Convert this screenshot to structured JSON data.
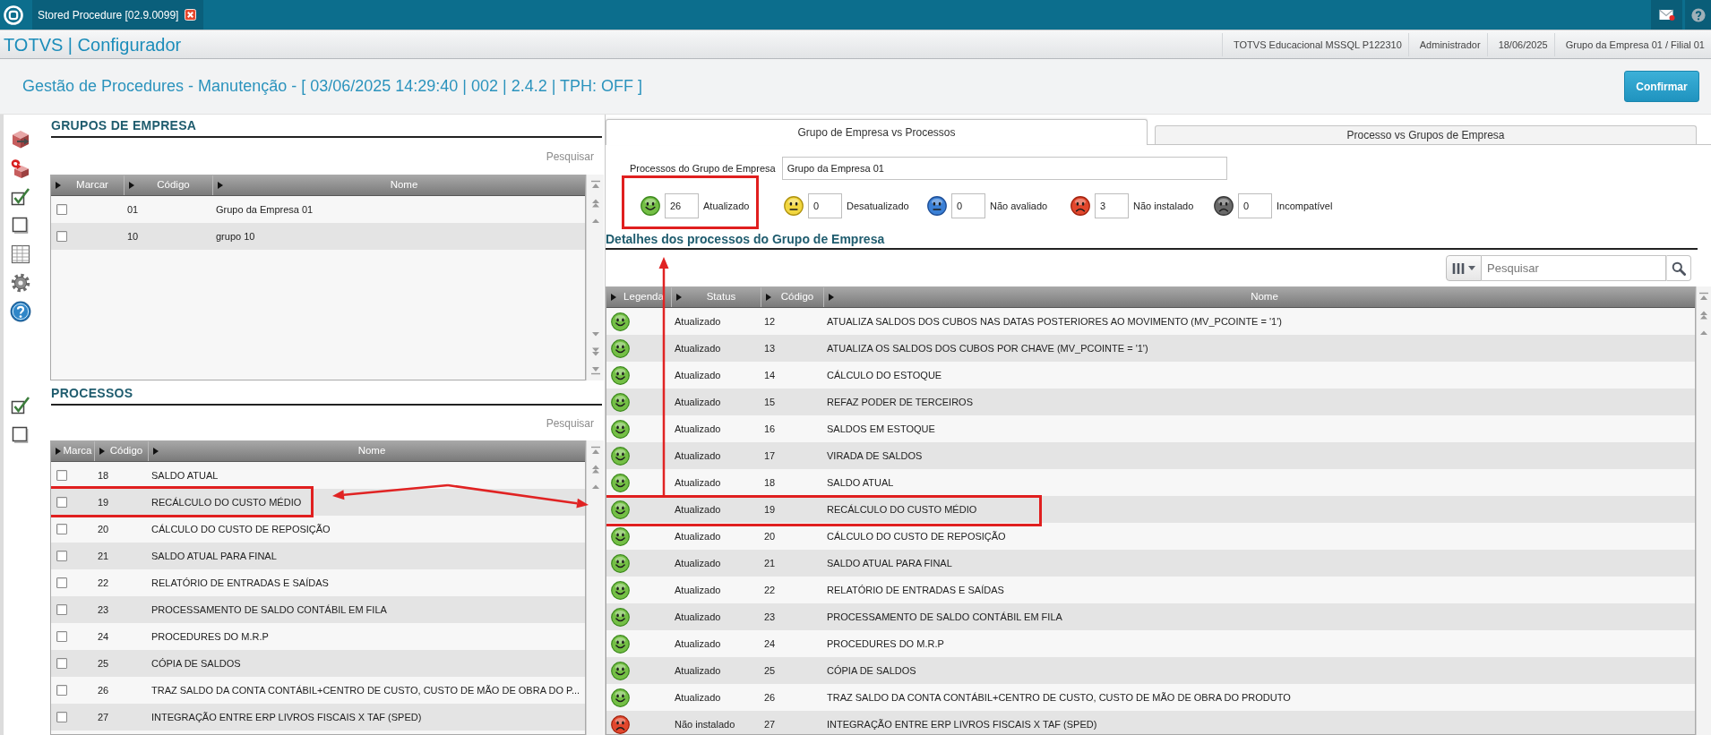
{
  "app_bar": {
    "tab_title": "Stored Procedure [02.9.0099]"
  },
  "header_bar": {
    "product": "TOTVS | Configurador",
    "info": [
      "TOTVS Educacional MSSQL P122310",
      "Administrador",
      "18/06/2025",
      "Grupo da Empresa 01 / Filial 01"
    ]
  },
  "page_header": {
    "title": "Gestão de Procedures - Manutenção - [ 03/06/2025 14:29:40 | 002 | 2.4.2 | TPH: OFF ]",
    "confirm_button": "Confirmar"
  },
  "company_groups": {
    "title": "GRUPOS DE EMPRESA",
    "search": {
      "placeholder": "Pesquisar"
    },
    "columns": [
      "Marcar",
      "Código",
      "Nome"
    ],
    "rows": [
      {
        "checked": false,
        "code": "01",
        "name": "Grupo da Empresa 01"
      },
      {
        "checked": false,
        "code": "10",
        "name": "grupo 10"
      }
    ]
  },
  "processes": {
    "title": "PROCESSOS",
    "search": {
      "placeholder": "Pesquisar"
    },
    "columns": [
      "Marca",
      "Código",
      "Nome"
    ],
    "rows": [
      {
        "checked": false,
        "code": "18",
        "name": "SALDO ATUAL",
        "highlighted": false
      },
      {
        "checked": false,
        "code": "19",
        "name": "RECÁLCULO DO CUSTO MÉDIO",
        "highlighted": true
      },
      {
        "checked": false,
        "code": "20",
        "name": "CÁLCULO DO CUSTO DE REPOSIÇÃO",
        "highlighted": false
      },
      {
        "checked": false,
        "code": "21",
        "name": "SALDO ATUAL PARA FINAL",
        "highlighted": false
      },
      {
        "checked": false,
        "code": "22",
        "name": "RELATÓRIO DE ENTRADAS E SAÍDAS",
        "highlighted": false
      },
      {
        "checked": false,
        "code": "23",
        "name": "PROCESSAMENTO DE SALDO CONTÁBIL EM FILA",
        "highlighted": false
      },
      {
        "checked": false,
        "code": "24",
        "name": "PROCEDURES DO M.R.P",
        "highlighted": false
      },
      {
        "checked": false,
        "code": "25",
        "name": "CÓPIA DE SALDOS",
        "highlighted": false
      },
      {
        "checked": false,
        "code": "26",
        "name": "TRAZ SALDO DA CONTA CONTÁBIL+CENTRO DE CUSTO, CUSTO DE MÃO DE OBRA DO P...",
        "highlighted": false
      },
      {
        "checked": false,
        "code": "27",
        "name": "INTEGRAÇÃO ENTRE ERP LIVROS FISCAIS X TAF (SPED)",
        "highlighted": false
      }
    ]
  },
  "tabs": [
    {
      "label": "Grupo de Empresa vs Processos",
      "selected": true
    },
    {
      "label": "Processo vs Grupos de Empresa",
      "selected": false
    }
  ],
  "group_field": {
    "label": "Processos do Grupo de Empresa",
    "value": "Grupo da Empresa 01"
  },
  "status_summary": [
    {
      "kind": "updated",
      "count": "26",
      "label": "Atualizado",
      "highlighted": true
    },
    {
      "kind": "outdated",
      "count": "0",
      "label": "Desatualizado",
      "highlighted": false
    },
    {
      "kind": "not_evaluated",
      "count": "0",
      "label": "Não avaliado",
      "highlighted": false
    },
    {
      "kind": "not_installed",
      "count": "3",
      "label": "Não instalado",
      "highlighted": false
    },
    {
      "kind": "incompatible",
      "count": "0",
      "label": "Incompatível",
      "highlighted": false
    }
  ],
  "details": {
    "title": "Detalhes dos processos do Grupo de Empresa",
    "search": {
      "placeholder": "Pesquisar"
    },
    "columns": [
      "Legenda",
      "Status",
      "Código",
      "Nome"
    ],
    "rows": [
      {
        "kind": "updated",
        "status": "Atualizado",
        "code": "12",
        "name": "ATUALIZA SALDOS DOS CUBOS NAS DATAS POSTERIORES AO MOVIMENTO (MV_PCOINTE = '1')",
        "highlighted": false
      },
      {
        "kind": "updated",
        "status": "Atualizado",
        "code": "13",
        "name": "ATUALIZA OS SALDOS DOS CUBOS POR CHAVE (MV_PCOINTE = '1')",
        "highlighted": false
      },
      {
        "kind": "updated",
        "status": "Atualizado",
        "code": "14",
        "name": "CÁLCULO DO ESTOQUE",
        "highlighted": false
      },
      {
        "kind": "updated",
        "status": "Atualizado",
        "code": "15",
        "name": "REFAZ PODER DE TERCEIROS",
        "highlighted": false
      },
      {
        "kind": "updated",
        "status": "Atualizado",
        "code": "16",
        "name": "SALDOS EM ESTOQUE",
        "highlighted": false
      },
      {
        "kind": "updated",
        "status": "Atualizado",
        "code": "17",
        "name": "VIRADA DE SALDOS",
        "highlighted": false
      },
      {
        "kind": "updated",
        "status": "Atualizado",
        "code": "18",
        "name": "SALDO ATUAL",
        "highlighted": false
      },
      {
        "kind": "updated",
        "status": "Atualizado",
        "code": "19",
        "name": "RECÁLCULO DO CUSTO MÉDIO",
        "highlighted": true
      },
      {
        "kind": "updated",
        "status": "Atualizado",
        "code": "20",
        "name": "CÁLCULO DO CUSTO DE REPOSIÇÃO",
        "highlighted": false
      },
      {
        "kind": "updated",
        "status": "Atualizado",
        "code": "21",
        "name": "SALDO ATUAL PARA FINAL",
        "highlighted": false
      },
      {
        "kind": "updated",
        "status": "Atualizado",
        "code": "22",
        "name": "RELATÓRIO DE ENTRADAS E SAÍDAS",
        "highlighted": false
      },
      {
        "kind": "updated",
        "status": "Atualizado",
        "code": "23",
        "name": "PROCESSAMENTO DE SALDO CONTÁBIL EM FILA",
        "highlighted": false
      },
      {
        "kind": "updated",
        "status": "Atualizado",
        "code": "24",
        "name": "PROCEDURES DO M.R.P",
        "highlighted": false
      },
      {
        "kind": "updated",
        "status": "Atualizado",
        "code": "25",
        "name": "CÓPIA DE SALDOS",
        "highlighted": false
      },
      {
        "kind": "updated",
        "status": "Atualizado",
        "code": "26",
        "name": "TRAZ SALDO DA CONTA CONTÁBIL+CENTRO DE CUSTO, CUSTO DE MÃO DE OBRA DO PRODUTO",
        "highlighted": false
      },
      {
        "kind": "not_installed",
        "status": "Não instalado",
        "code": "27",
        "name": "INTEGRAÇÃO ENTRE ERP LIVROS FISCAIS X TAF (SPED)",
        "highlighted": false
      }
    ]
  }
}
